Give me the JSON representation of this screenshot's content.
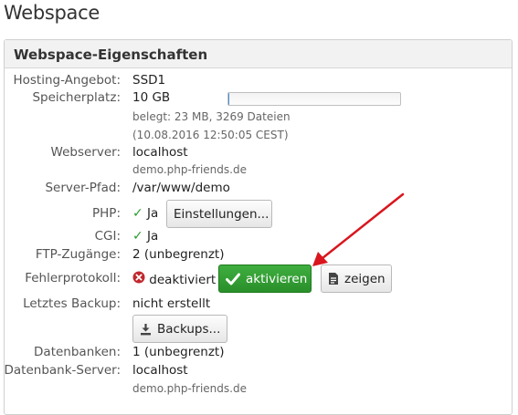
{
  "page": {
    "title": "Webspace"
  },
  "panel": {
    "title": "Webspace-Eigenschaften",
    "rows": {
      "hosting": {
        "label": "Hosting-Angebot:",
        "value": "SSD1"
      },
      "storage": {
        "label": "Speicherplatz:",
        "value": "10 GB",
        "usage_detail": "belegt: 23 MB, 3269 Dateien",
        "timestamp": "(10.08.2016 12:50:05 CEST)",
        "usage_fraction": 0.002
      },
      "webserver": {
        "label": "Webserver:",
        "value": "localhost",
        "domain": "demo.php-friends.de"
      },
      "server_path": {
        "label": "Server-Pfad:",
        "value": "/var/www/demo"
      },
      "php": {
        "label": "PHP:",
        "value": "Ja",
        "button": "Einstellungen..."
      },
      "cgi": {
        "label": "CGI:",
        "value": "Ja"
      },
      "ftp": {
        "label": "FTP-Zugänge:",
        "value": "2 (unbegrenzt)"
      },
      "error_log": {
        "label": "Fehlerprotokoll:",
        "status": "deaktiviert",
        "activate_button": "aktivieren",
        "show_button": "zeigen"
      },
      "backup": {
        "label": "Letztes Backup:",
        "value": "nicht erstellt",
        "button": "Backups..."
      },
      "databases": {
        "label": "Datenbanken:",
        "value": "1 (unbegrenzt)"
      },
      "db_server": {
        "label": "Datenbank-Server:",
        "value": "localhost",
        "domain": "demo.php-friends.de"
      }
    }
  },
  "colors": {
    "accent_green": "#2e9a2e",
    "error_red": "#c0282d",
    "annotation_arrow": "#d9161e",
    "progress_fill": "#4a8fd6"
  },
  "icons": {
    "check": "check-icon",
    "error": "error-circle-icon",
    "download": "download-icon",
    "document": "document-icon"
  }
}
